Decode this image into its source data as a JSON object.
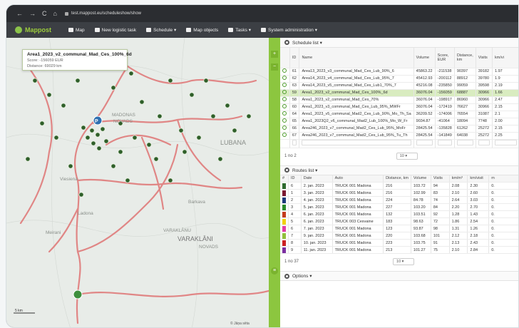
{
  "browser": {
    "url": "test.mappost.eu/scheduleshow/show",
    "nav": [
      "←",
      "→",
      "C",
      "⌂"
    ]
  },
  "app": {
    "brand": "Mappost",
    "nav": [
      {
        "label": "Map",
        "icon": "map-icon"
      },
      {
        "label": "New logistic task",
        "icon": "truck-icon"
      },
      {
        "label": "Schedule ▾",
        "icon": "calendar-icon"
      },
      {
        "label": "Map objects",
        "icon": "pin-icon"
      },
      {
        "label": "Tasks ▾",
        "icon": "clipboard-icon"
      },
      {
        "label": "System administration ▾",
        "icon": "gears-icon"
      }
    ]
  },
  "map": {
    "tooltip": {
      "title": "Area1_2023_v2_communal_Mad_Ces_100%_6d",
      "score": "Score: -156059 EUR",
      "distance": "Distance: 69029 km"
    },
    "labels": [
      "MADONAS",
      "NOVADS",
      "LUBANA",
      "Barkava",
      "Ladona",
      "Viesiena",
      "Meirani",
      "VARAKLĀNI",
      "NOVADS",
      "VARAKLĀNU"
    ],
    "scale": "5 km",
    "attribution": "© Jāņa sēta",
    "parking": "P"
  },
  "schedule": {
    "title": "Schedule list ▾",
    "columns": [
      "ID",
      "Name",
      "Volume",
      "Score, EUR",
      "Distance, km",
      "Visits",
      "km/vi"
    ],
    "rows": [
      [
        "61",
        "Area13_2023_v3_communal_Mad_Ces_Lub_90%_6",
        "45863.22",
        "-211538",
        "90397",
        "39182",
        "1.97"
      ],
      [
        "62",
        "Area14_2023_v4_communal_Mad_Ces_Lub_95%_7",
        "45412.93",
        "-200112",
        "88912",
        "39780",
        "1.9"
      ],
      [
        "63",
        "Area14_2023_v5_communal_Mad_Ces_Lub1_70%_7",
        "45216.08",
        "-235850",
        "99059",
        "39598",
        "2.19"
      ],
      [
        "59",
        "Area1_2023_v2_communal_Mad_Ces_100%_6d",
        "36076.04",
        "-156059",
        "68887",
        "30966",
        "1.66"
      ],
      [
        "58",
        "Area1_2023_v2_communal_Mad_Ces_70%",
        "36076.04",
        "-198917",
        "86960",
        "30966",
        "2.47"
      ],
      [
        "60",
        "Area1_2023_v3_communal_Mad_Ces_Lub_95%_MWFr",
        "36076.04",
        "-172419",
        "76627",
        "30966",
        "2.15"
      ],
      [
        "64",
        "Area1_2023_v5_communal_Mad2_Ces_Lub_90%_Mo_Th_Sa",
        "36209.52",
        "-174006",
        "76554",
        "31087",
        "2.1"
      ],
      [
        "65",
        "Area1_2023Q2_v6_communal_Mad2_Lub_100%_Mo_W_Fr",
        "9034.87",
        "-41064",
        "18094",
        "7748",
        "2.00"
      ],
      [
        "66",
        "Area246_2023_v7_communal_Mad2_Ces_Lub_95%_MoFr",
        "28425.54",
        "-135828",
        "61262",
        "25272",
        "2.15"
      ],
      [
        "67",
        "Area246_2023_v7_communal_Mad2_Ces_Lub_95%_Tu_Th",
        "28425.54",
        "-141849",
        "64038",
        "25272",
        "2.25"
      ]
    ],
    "selected_index": 3,
    "pager_text": "1 no 2",
    "page_size": "10 ▾"
  },
  "routes": {
    "title": "Routes list ▾",
    "columns": [
      "#",
      "ID",
      "Date",
      "Auto",
      "Distance, km",
      "Volume",
      "Visits",
      "km/m³",
      "km/visit",
      "m"
    ],
    "rows": [
      {
        "c": "#2f6b2f",
        "v": [
          "6",
          "2. jan. 2023",
          "TRUCK 001 Madona",
          "216",
          "103.72",
          "94",
          "2.08",
          "2.30",
          "0."
        ]
      },
      {
        "c": "#7a1830",
        "v": [
          "1",
          "3. jan. 2023",
          "TRUCK 001 Madona",
          "216",
          "102.99",
          "83",
          "2.10",
          "2.60",
          "0."
        ]
      },
      {
        "c": "#1e3a7a",
        "v": [
          "2",
          "4. jan. 2023",
          "TRUCK 001 Madona",
          "224",
          "84.78",
          "74",
          "2.64",
          "3.03",
          "0."
        ]
      },
      {
        "c": "#2b8a2b",
        "v": [
          "3",
          "5. jan. 2023",
          "TRUCK 001 Madona",
          "227",
          "103.20",
          "84",
          "2.20",
          "2.70",
          "0."
        ]
      },
      {
        "c": "#c43b1e",
        "v": [
          "4",
          "6. jan. 2023",
          "TRUCK 001 Madona",
          "132",
          "103.51",
          "92",
          "1.28",
          "1.43",
          "0."
        ]
      },
      {
        "c": "#f0d010",
        "v": [
          "5",
          "6. jan. 2023",
          "TRUCK 003 Cesvaine",
          "183",
          "98.63",
          "72",
          "1.86",
          "2.54",
          "0."
        ]
      },
      {
        "c": "#e23aa8",
        "v": [
          "6",
          "7. jan. 2023",
          "TRUCK 001 Madona",
          "123",
          "93.87",
          "98",
          "1.31",
          "1.26",
          "0."
        ]
      },
      {
        "c": "#8fc03a",
        "v": [
          "7",
          "9. jan. 2023",
          "TRUCK 001 Madona",
          "220",
          "103.68",
          "101",
          "2.12",
          "2.18",
          "0."
        ]
      },
      {
        "c": "#cc2222",
        "v": [
          "8",
          "10. jan. 2023",
          "TRUCK 001 Madona",
          "223",
          "103.75",
          "91",
          "2.13",
          "2.43",
          "0."
        ]
      },
      {
        "c": "#7b2fa0",
        "v": [
          "9",
          "11. jan. 2023",
          "TRUCK 001 Madona",
          "213",
          "101.27",
          "75",
          "2.10",
          "2.84",
          "0."
        ]
      }
    ],
    "pager_text": "1 no 37",
    "page_size": "10 ▾"
  },
  "options": {
    "title": "Options ▾"
  }
}
